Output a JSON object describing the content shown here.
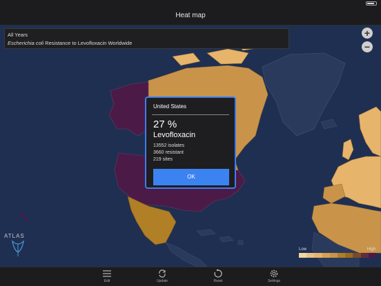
{
  "navbar": {
    "title": "Heat map"
  },
  "info": {
    "period": "All Years",
    "organism": "Escherichia coli",
    "description_rest": " Resistance to Levofloxacin Worldwide"
  },
  "popup": {
    "country": "United States",
    "percent": "27 %",
    "drug": "Levofloxacin",
    "isolates": "13552 isolates",
    "resistant": "3660 resistant",
    "sites": "219 sites",
    "ok_label": "OK"
  },
  "legend": {
    "low": "Low",
    "high": "High"
  },
  "logo": {
    "text": "ATLAS"
  },
  "toolbar": {
    "edit": "Edit",
    "update": "Update",
    "reset": "Reset",
    "settings": "Settings"
  },
  "colors": {
    "ocean": "#1f2f52",
    "no_data_land": "#2a3a5c",
    "low": "#e7b46c",
    "mid": "#b07f26",
    "high": "#4b1a46",
    "accent": "#3c83f2"
  },
  "icons": [
    "zoom-in-icon",
    "zoom-out-icon",
    "edit-icon",
    "update-icon",
    "reset-icon",
    "settings-icon"
  ]
}
